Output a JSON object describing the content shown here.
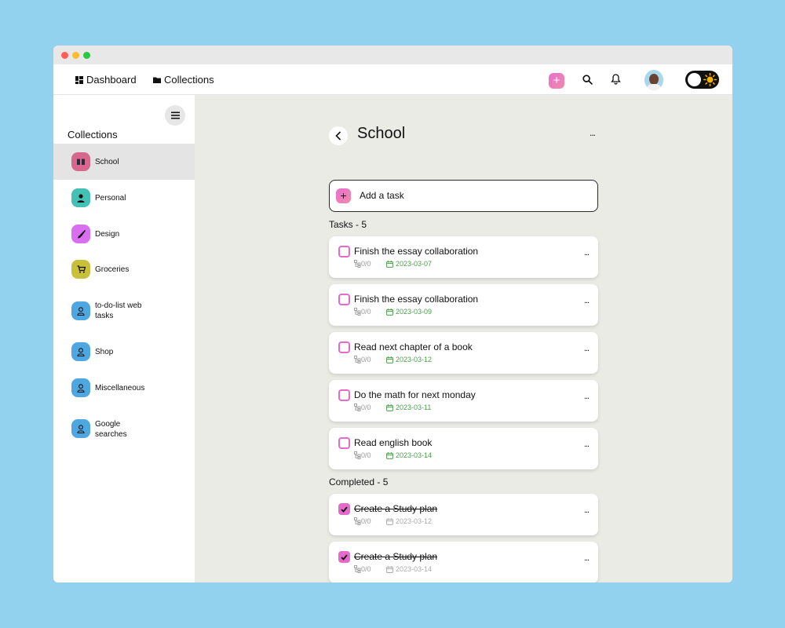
{
  "navbar": {
    "dashboard_label": "Dashboard",
    "collections_label": "Collections",
    "add_icon": "plus-icon",
    "search_icon": "search-icon",
    "bell_icon": "bell-icon",
    "theme_toggle_icon": "sun-icon"
  },
  "sidebar": {
    "title": "Collections",
    "items": [
      {
        "label": "School",
        "icon": "book-icon",
        "color": "#d8678f",
        "active": true
      },
      {
        "label": "Personal",
        "icon": "person-icon",
        "color": "#44c0b4"
      },
      {
        "label": "Design",
        "icon": "brush-icon",
        "color": "#d96ef0"
      },
      {
        "label": "Groceries",
        "icon": "cart-icon",
        "color": "#c9c03a"
      },
      {
        "label": "to-do-list web tasks",
        "icon": "user-outline-icon",
        "color": "#4fa7e2"
      },
      {
        "label": "Shop",
        "icon": "user-outline-icon",
        "color": "#4fa7e2"
      },
      {
        "label": "Miscellaneous",
        "icon": "user-outline-icon",
        "color": "#4fa7e2"
      },
      {
        "label": "Google searches",
        "icon": "user-outline-icon",
        "color": "#4fa7e2"
      }
    ]
  },
  "main": {
    "title": "School",
    "more": "...",
    "add_task_label": "Add a task",
    "tasks_heading": "Tasks - 5",
    "completed_heading": "Completed - 5",
    "tasks": [
      {
        "title": "Finish the essay collaboration",
        "subtasks": "0/0",
        "date": "2023-03-07"
      },
      {
        "title": "Finish the essay collaboration",
        "subtasks": "0/0",
        "date": "2023-03-09"
      },
      {
        "title": "Read next chapter of a book",
        "subtasks": "0/0",
        "date": "2023-03-12"
      },
      {
        "title": "Do the math for next monday",
        "subtasks": "0/0",
        "date": "2023-03-11"
      },
      {
        "title": "Read english book",
        "subtasks": "0/0",
        "date": "2023-03-14"
      }
    ],
    "completed": [
      {
        "title": "Create a Study plan",
        "subtasks": "0/0",
        "date": "2023-03-12"
      },
      {
        "title": "Create a Study plan",
        "subtasks": "0/0",
        "date": "2023-03-14"
      }
    ]
  },
  "colors": {
    "accent": "#e46bc9",
    "date_green": "#4a9e4a",
    "main_bg": "#ebebe6",
    "page_bg": "#92d2ef"
  }
}
